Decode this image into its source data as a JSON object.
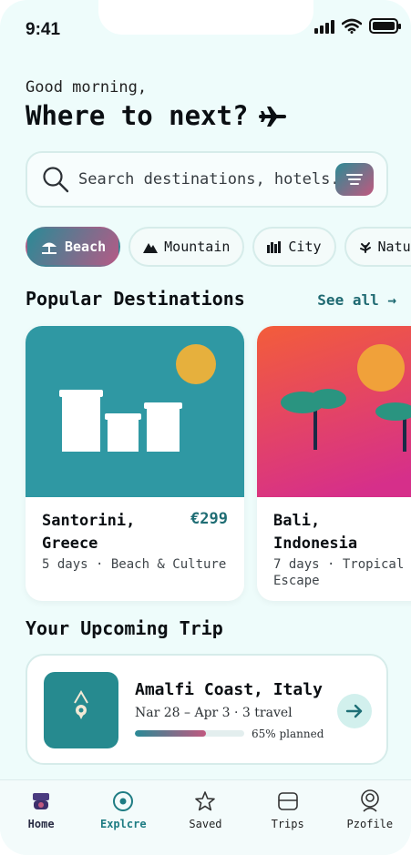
{
  "status_bar": {
    "time": "9:41"
  },
  "greeting": "Good morning,",
  "headline": "Where to next?",
  "search": {
    "placeholder": "Search destinations, hotels.."
  },
  "categories": [
    {
      "label": "Beach",
      "active": true
    },
    {
      "label": "Mountain",
      "active": false
    },
    {
      "label": "City",
      "active": false
    },
    {
      "label": "Nature",
      "active": false
    }
  ],
  "popular": {
    "title": "Popular Destinations",
    "see_all": "See all →",
    "cards": [
      {
        "name_line1": "Santorini,",
        "name_line2": "Greece",
        "price": "€299",
        "meta_line1": "5 days · Beach & Culture",
        "meta_line2": ""
      },
      {
        "name_line1": "Bali,",
        "name_line2": "Indonesia",
        "price": "",
        "meta_line1": "7 days · Tropical",
        "meta_line2": "Escape"
      }
    ]
  },
  "upcoming": {
    "title": "Your Upcoming Trip",
    "trip_name": "Amalfi Coast, Italy",
    "dates": "Nar 28 – Apr 3 · 3 travel",
    "progress_fraction": 0.65,
    "progress_label": "65% planned"
  },
  "tabs": [
    {
      "label": "Home",
      "icon": "home-icon",
      "active": false
    },
    {
      "label": "Explcre",
      "icon": "compass-icon",
      "active": true
    },
    {
      "label": "Saved",
      "icon": "star-icon",
      "active": false
    },
    {
      "label": "Trips",
      "icon": "suitcase-icon",
      "active": false
    },
    {
      "label": "Pzofile",
      "icon": "profile-icon",
      "active": false
    }
  ],
  "colors": {
    "accent_teal": "#2a8a96",
    "accent_pink": "#c0587f",
    "background": "#eefcfb",
    "santorini_sky": "#2f98a3",
    "bali_gradient_top": "#f35d3a",
    "bali_gradient_bottom": "#d62f8a",
    "sun": "#e6b03d"
  }
}
